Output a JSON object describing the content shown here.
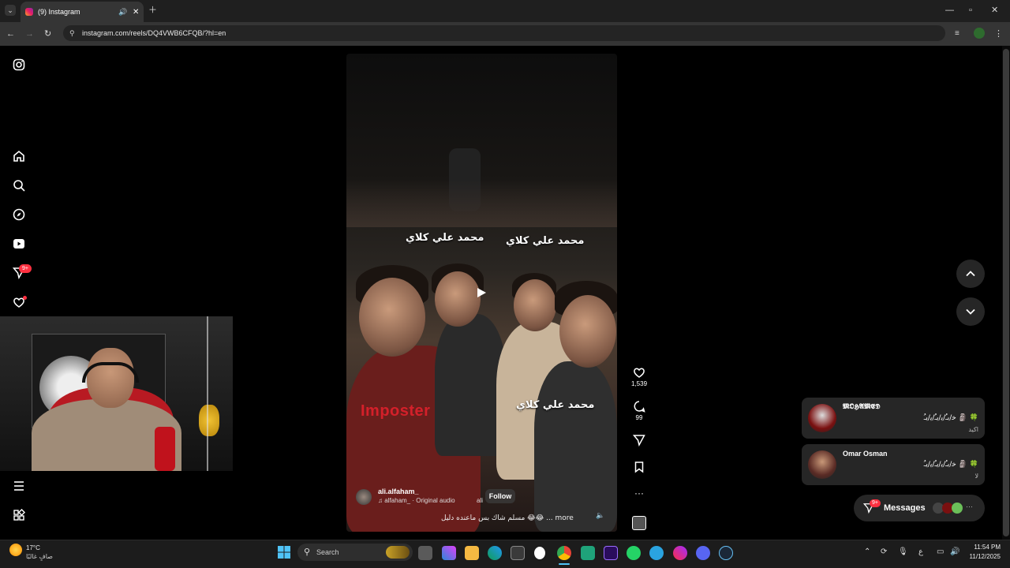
{
  "browser": {
    "tab_title": "(9) Instagram",
    "url": "instagram.com/reels/DQ4VWB6CFQB/?hl=en"
  },
  "sidebar": {
    "notifications_badge": "9+"
  },
  "reel": {
    "captions": [
      "محمد علي كلاي",
      "محمد علي كلاي",
      "محمد علي كلاي"
    ],
    "overlay_text": "Imposter",
    "username": "ali.alfaham_",
    "audio": "♫ alfaham_ · Original audio",
    "audio_tag": "ali",
    "follow_label": "Follow",
    "description": "مسلم شاك بس ماعنده دليل 😂😂 ... more",
    "likes": "1,539",
    "comments": "99"
  },
  "messages": {
    "cards": [
      {
        "name": "𝕸𝕺𝕳𝕬𝕸𝕰𝕯",
        "preview": "ﺧ/ﺑـُ/ﯾ/ﯾـُ/ﯾ/ﯾـُ 🗿 🍀",
        "sub": "اكيد"
      },
      {
        "name": "Omar Osman",
        "preview": "ﺧ/ﺑـُ/ﯾ/ﯾـُ/ﯾ/ﯾـُ 🗿 🍀",
        "sub": "لا"
      }
    ],
    "label": "Messages",
    "badge": "9+"
  },
  "taskbar": {
    "weather_temp": "17°C",
    "weather_desc": "صافٍ غالبًا",
    "search_placeholder": "Search",
    "lang": "ع",
    "time": "11:54 PM",
    "date": "11/12/2025"
  },
  "colors": {
    "accent_red": "#ff3040",
    "imposter_red": "#d4202a"
  }
}
